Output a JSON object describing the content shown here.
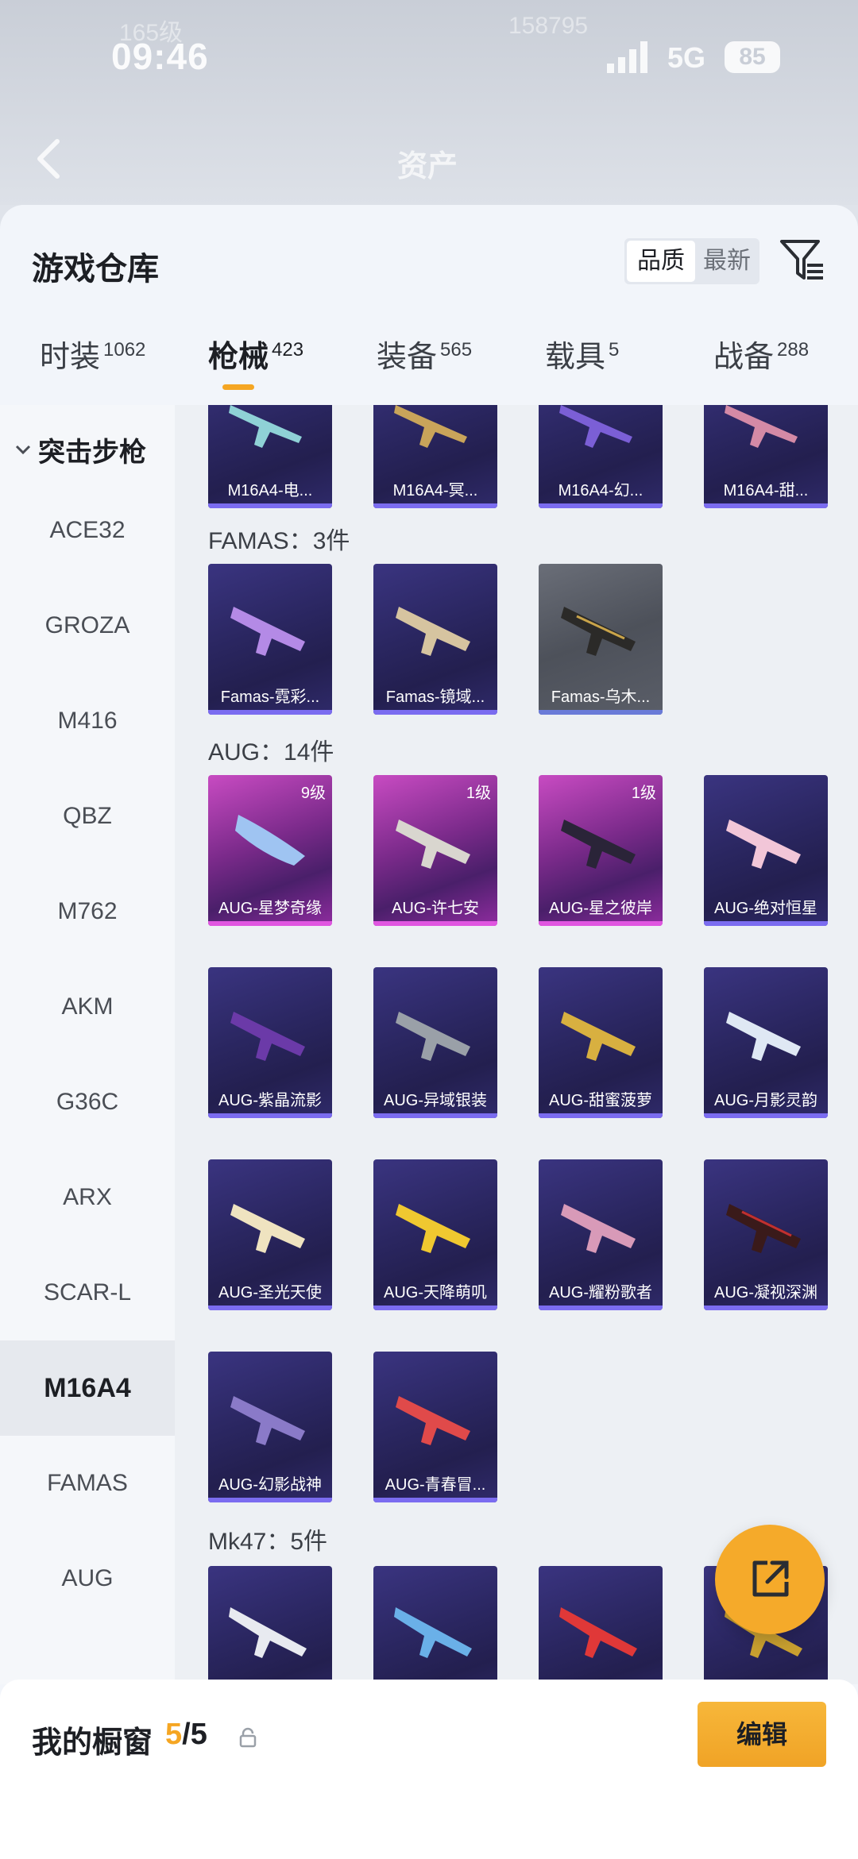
{
  "status": {
    "time": "09:46",
    "network": "5G",
    "battery": "85",
    "ghost_left": "165级",
    "ghost_right": "158795"
  },
  "header": {
    "title": "资产"
  },
  "sheet": {
    "title": "游戏仓库",
    "sort": {
      "quality": "品质",
      "latest": "最新"
    },
    "tabs": [
      {
        "label": "时装",
        "count": "1062"
      },
      {
        "label": "枪械",
        "count": "423"
      },
      {
        "label": "装备",
        "count": "565"
      },
      {
        "label": "载具",
        "count": "5"
      },
      {
        "label": "战备",
        "count": "288"
      }
    ]
  },
  "sidebar": {
    "category": "突击步枪",
    "items": [
      "ACE32",
      "GROZA",
      "M416",
      "QBZ",
      "M762",
      "AKM",
      "G36C",
      "ARX",
      "SCAR-L",
      "M16A4",
      "FAMAS",
      "AUG"
    ]
  },
  "sections": {
    "famas": "FAMAS：3件",
    "aug": "AUG：14件",
    "mk47": "Mk47：5件"
  },
  "cards": {
    "m16": [
      "M16A4-电...",
      "M16A4-冥...",
      "M16A4-幻...",
      "M16A4-甜..."
    ],
    "famas": [
      "Famas-霓彩...",
      "Famas-镜域...",
      "Famas-乌木..."
    ],
    "aug": [
      {
        "name": "AUG-星梦奇缘",
        "level": "9级"
      },
      {
        "name": "AUG-许七安",
        "level": "1级"
      },
      {
        "name": "AUG-星之彼岸",
        "level": "1级"
      },
      {
        "name": "AUG-绝对恒星",
        "level": ""
      },
      {
        "name": "AUG-紫晶流影",
        "level": ""
      },
      {
        "name": "AUG-异域银装",
        "level": ""
      },
      {
        "name": "AUG-甜蜜菠萝",
        "level": ""
      },
      {
        "name": "AUG-月影灵韵",
        "level": ""
      },
      {
        "name": "AUG-圣光天使",
        "level": ""
      },
      {
        "name": "AUG-天降萌叽",
        "level": ""
      },
      {
        "name": "AUG-耀粉歌者",
        "level": ""
      },
      {
        "name": "AUG-凝视深渊",
        "level": ""
      },
      {
        "name": "AUG-幻影战神",
        "level": ""
      },
      {
        "name": "AUG-青春冒...",
        "level": ""
      }
    ]
  },
  "bottom": {
    "label": "我的橱窗",
    "count_current": "5",
    "count_total": "/5",
    "edit": "编辑"
  },
  "colors": {
    "accent": "#f5a623",
    "purple_card": "#2a2660",
    "pink_card": "#c84bc2"
  }
}
